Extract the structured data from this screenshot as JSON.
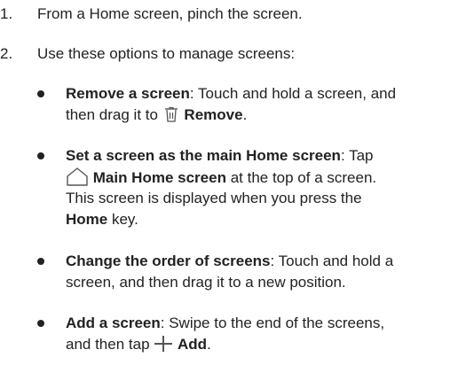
{
  "steps": [
    {
      "number": "1.",
      "text": "From a Home screen, pinch the screen."
    },
    {
      "number": "2.",
      "text": "Use these options to manage screens:"
    }
  ],
  "bullets": {
    "remove": {
      "title": "Remove a screen",
      "line1": ": Touch and hold a screen, and",
      "line2_pre": "then drag it to ",
      "line2_bold": "Remove",
      "line2_post": ".",
      "icon": "trash-icon"
    },
    "main": {
      "title": "Set a screen as the main Home screen",
      "line1_post": ": Tap",
      "line2_bold": "Main Home screen",
      "line2_post": " at the top of a screen.",
      "line3": "This screen is displayed when you press the",
      "line4_bold": "Home",
      "line4_post": " key.",
      "icon": "home-icon"
    },
    "order": {
      "title": "Change the order of screens",
      "line1_post": ": Touch and hold a",
      "line2": "screen, and then drag it to a new position."
    },
    "add": {
      "title": "Add a screen",
      "line1_post": ": Swipe to the end of the screens,",
      "line2_pre": "and then tap ",
      "line2_bold": "Add",
      "line2_post": ".",
      "icon": "plus-icon"
    }
  }
}
